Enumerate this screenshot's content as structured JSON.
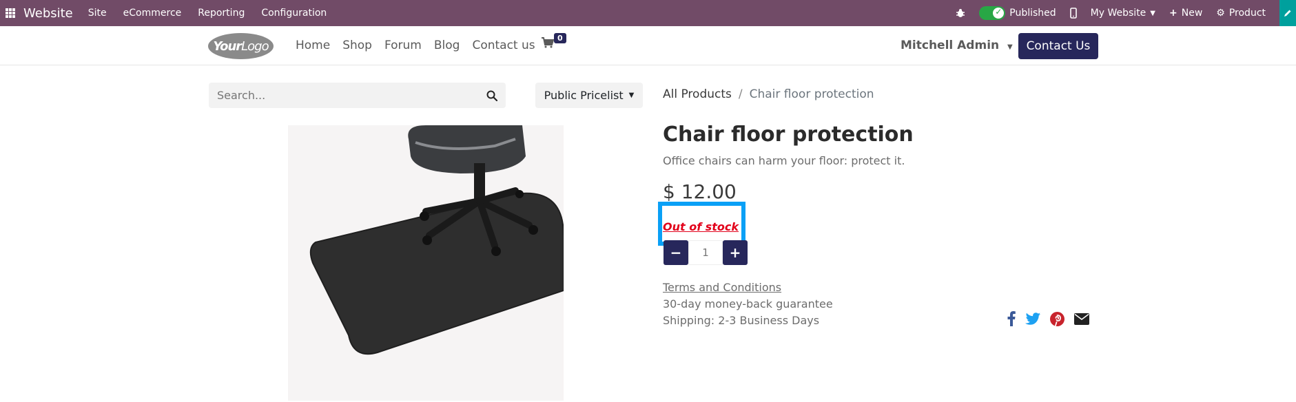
{
  "topbar": {
    "brand": "Website",
    "menu": [
      "Site",
      "eCommerce",
      "Reporting",
      "Configuration"
    ],
    "published_label": "Published",
    "website_label": "My Website",
    "new_label": "New",
    "product_label": "Product"
  },
  "header": {
    "logo_text_bold": "Your",
    "logo_text": "Logo",
    "nav": [
      "Home",
      "Shop",
      "Forum",
      "Blog",
      "Contact us"
    ],
    "cart_count": "0",
    "user_name": "Mitchell Admin",
    "contact_button": "Contact Us"
  },
  "search": {
    "placeholder": "Search..."
  },
  "pricelist": {
    "label": "Public Pricelist"
  },
  "breadcrumb": {
    "parent": "All Products",
    "separator": "/",
    "current": "Chair floor protection"
  },
  "product": {
    "title": "Chair floor protection",
    "description": "Office chairs can harm your floor: protect it.",
    "price": "$ 12.00",
    "stock_status": "Out of stock",
    "quantity": "1",
    "minus_label": "−",
    "plus_label": "+",
    "terms": "Terms and Conditions",
    "guarantee": "30-day money-back guarantee",
    "shipping": "Shipping: 2-3 Business Days"
  },
  "colors": {
    "topbar": "#714b67",
    "primary": "#27275b",
    "published_toggle": "#28a745",
    "out_of_stock": "#e2001a",
    "highlight": "#0aa0f6",
    "facebook": "#3b5998",
    "twitter": "#1da1f2",
    "pinterest": "#c8232c"
  }
}
